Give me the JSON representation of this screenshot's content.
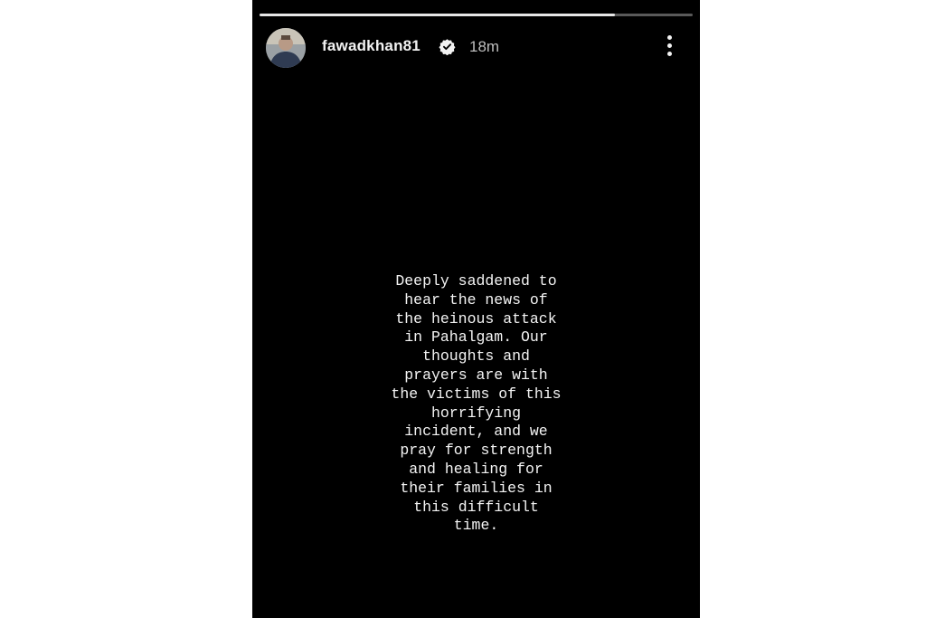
{
  "story": {
    "progress": 0.82,
    "username": "fawadkhan81",
    "verified": true,
    "timestamp": "18m",
    "message_lines": [
      "Deeply saddened to",
      "hear the news of",
      "the heinous attack",
      "in Pahalgam. Our",
      "thoughts and",
      "prayers are with",
      "the victims of this",
      "horrifying",
      "incident, and we",
      "pray for strength",
      "and healing for",
      "their families in",
      "this difficult",
      "time."
    ]
  },
  "icons": {
    "verified": "verified-badge-icon",
    "more": "more-vertical-icon"
  },
  "colors": {
    "background": "#000000",
    "text": "#f4f4f4",
    "timestamp": "#bfbfbf",
    "page": "#ffffff"
  }
}
